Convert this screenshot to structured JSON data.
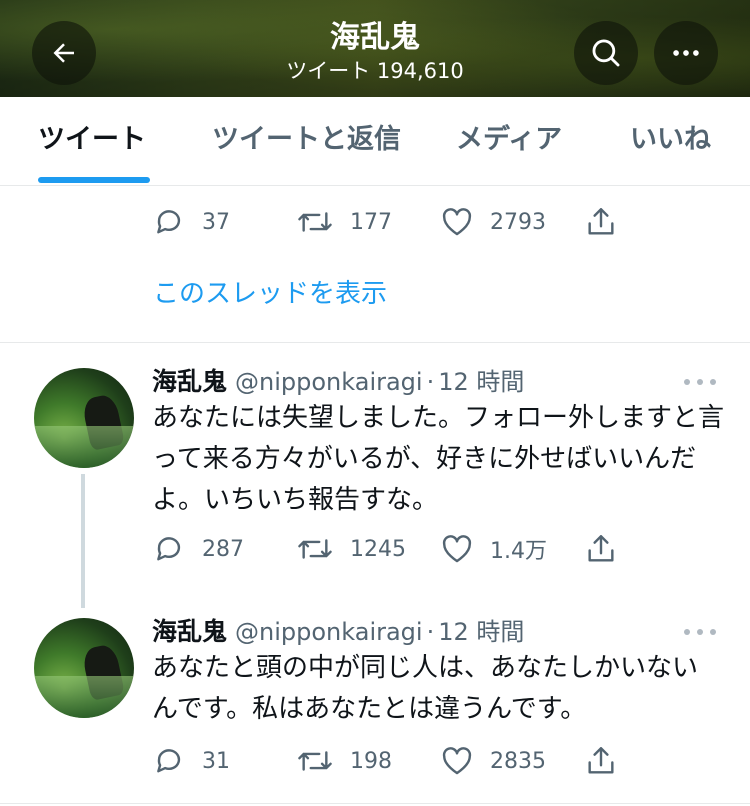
{
  "header": {
    "title": "海乱鬼",
    "subtitle": "ツイート 194,610",
    "back_icon": "arrow-left-icon",
    "search_icon": "search-icon",
    "more_icon": "more-horizontal-icon"
  },
  "tabs": [
    {
      "label": "ツイート",
      "active": true
    },
    {
      "label": "ツイートと返信",
      "active": false
    },
    {
      "label": "メディア",
      "active": false
    },
    {
      "label": "いいね",
      "active": false
    }
  ],
  "top_tweet_actions": {
    "replies": "37",
    "retweets": "177",
    "likes": "2793"
  },
  "show_thread_label": "このスレッドを表示",
  "tweets": [
    {
      "name": "海乱鬼",
      "handle": "@nipponkairagi",
      "separator": "·",
      "time": "12 時間",
      "text": "あなたには失望しました。フォロー外しますと言って来る方々がいるが、好きに外せばいいんだよ。いちいち報告すな。",
      "replies": "287",
      "retweets": "1245",
      "likes": "1.4万"
    },
    {
      "name": "海乱鬼",
      "handle": "@nipponkairagi",
      "separator": "·",
      "time": "12 時間",
      "text": "あなたと頭の中が同じ人は、あなたしかいないんです。私はあなたとは違うんです。",
      "replies": "31",
      "retweets": "198",
      "likes": "2835"
    }
  ],
  "colors": {
    "accent": "#1d9bf0",
    "secondary_text": "#536471",
    "primary_text": "#0f1419",
    "divider": "#e7e9ea"
  }
}
